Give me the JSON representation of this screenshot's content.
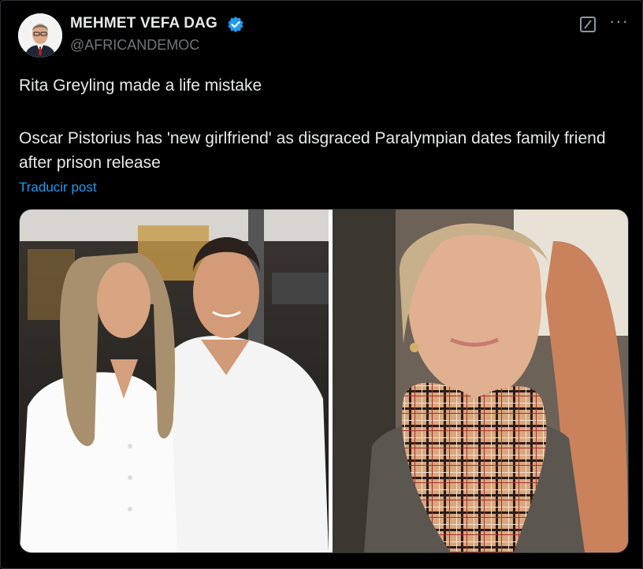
{
  "author": {
    "name": "MEHMET VEFA DAG",
    "handle": "@AFRICANDEMOC",
    "verified": true,
    "verified_color": "#1d9bf0"
  },
  "icons": {
    "verified": "verified-badge-icon",
    "grok": "grok-icon",
    "more": "more-options-icon"
  },
  "post": {
    "line1": "Rita Greyling made a life mistake",
    "line2": "Oscar Pistorius has 'new girlfriend' as disgraced Paralympian dates family friend after prison release",
    "translate_label": "Traducir post"
  },
  "colors": {
    "background": "#000000",
    "text": "#e7e9ea",
    "secondary": "#71767b",
    "link": "#1d9bf0"
  }
}
